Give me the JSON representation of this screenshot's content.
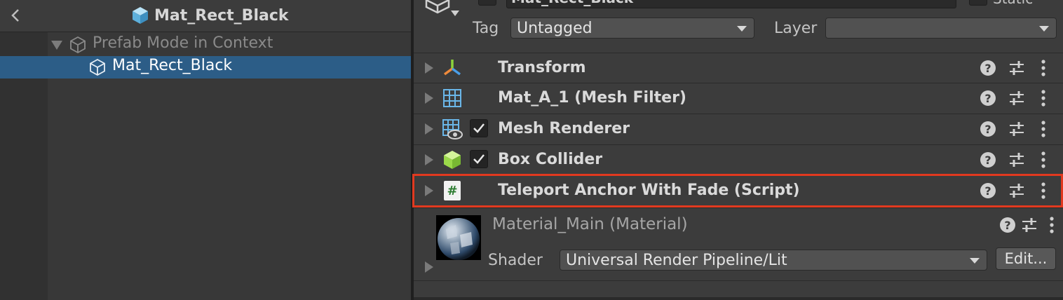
{
  "hierarchy": {
    "title": "Mat_Rect_Black",
    "rows": [
      {
        "label": "Prefab Mode in Context"
      },
      {
        "label": "Mat_Rect_Black"
      }
    ]
  },
  "inspector": {
    "object_name": "Mat_Rect_Black",
    "static_label": "Static",
    "tag_label": "Tag",
    "tag_value": "Untagged",
    "layer_label": "Layer",
    "layer_value": "",
    "components": [
      {
        "title": "Transform",
        "icon": "transform-icon",
        "has_checkbox": false
      },
      {
        "title": "Mat_A_1 (Mesh Filter)",
        "icon": "mesh-filter-icon",
        "has_checkbox": false
      },
      {
        "title": "Mesh Renderer",
        "icon": "mesh-renderer-icon",
        "has_checkbox": true,
        "enabled": true
      },
      {
        "title": "Box Collider",
        "icon": "box-collider-icon",
        "has_checkbox": true,
        "enabled": true
      },
      {
        "title": "Teleport Anchor With Fade (Script)",
        "icon": "script-icon",
        "has_checkbox": false,
        "highlighted": true
      }
    ],
    "help_glyph": "?",
    "script_glyph": "#",
    "material": {
      "name": "Material_Main",
      "type": "(Material)",
      "shader_label": "Shader",
      "shader_value": "Universal Render Pipeline/Lit",
      "edit_label": "Edit..."
    }
  },
  "colors": {
    "selection": "#2c5d87",
    "highlight": "#e2391f",
    "panel": "#3c3c3c"
  }
}
